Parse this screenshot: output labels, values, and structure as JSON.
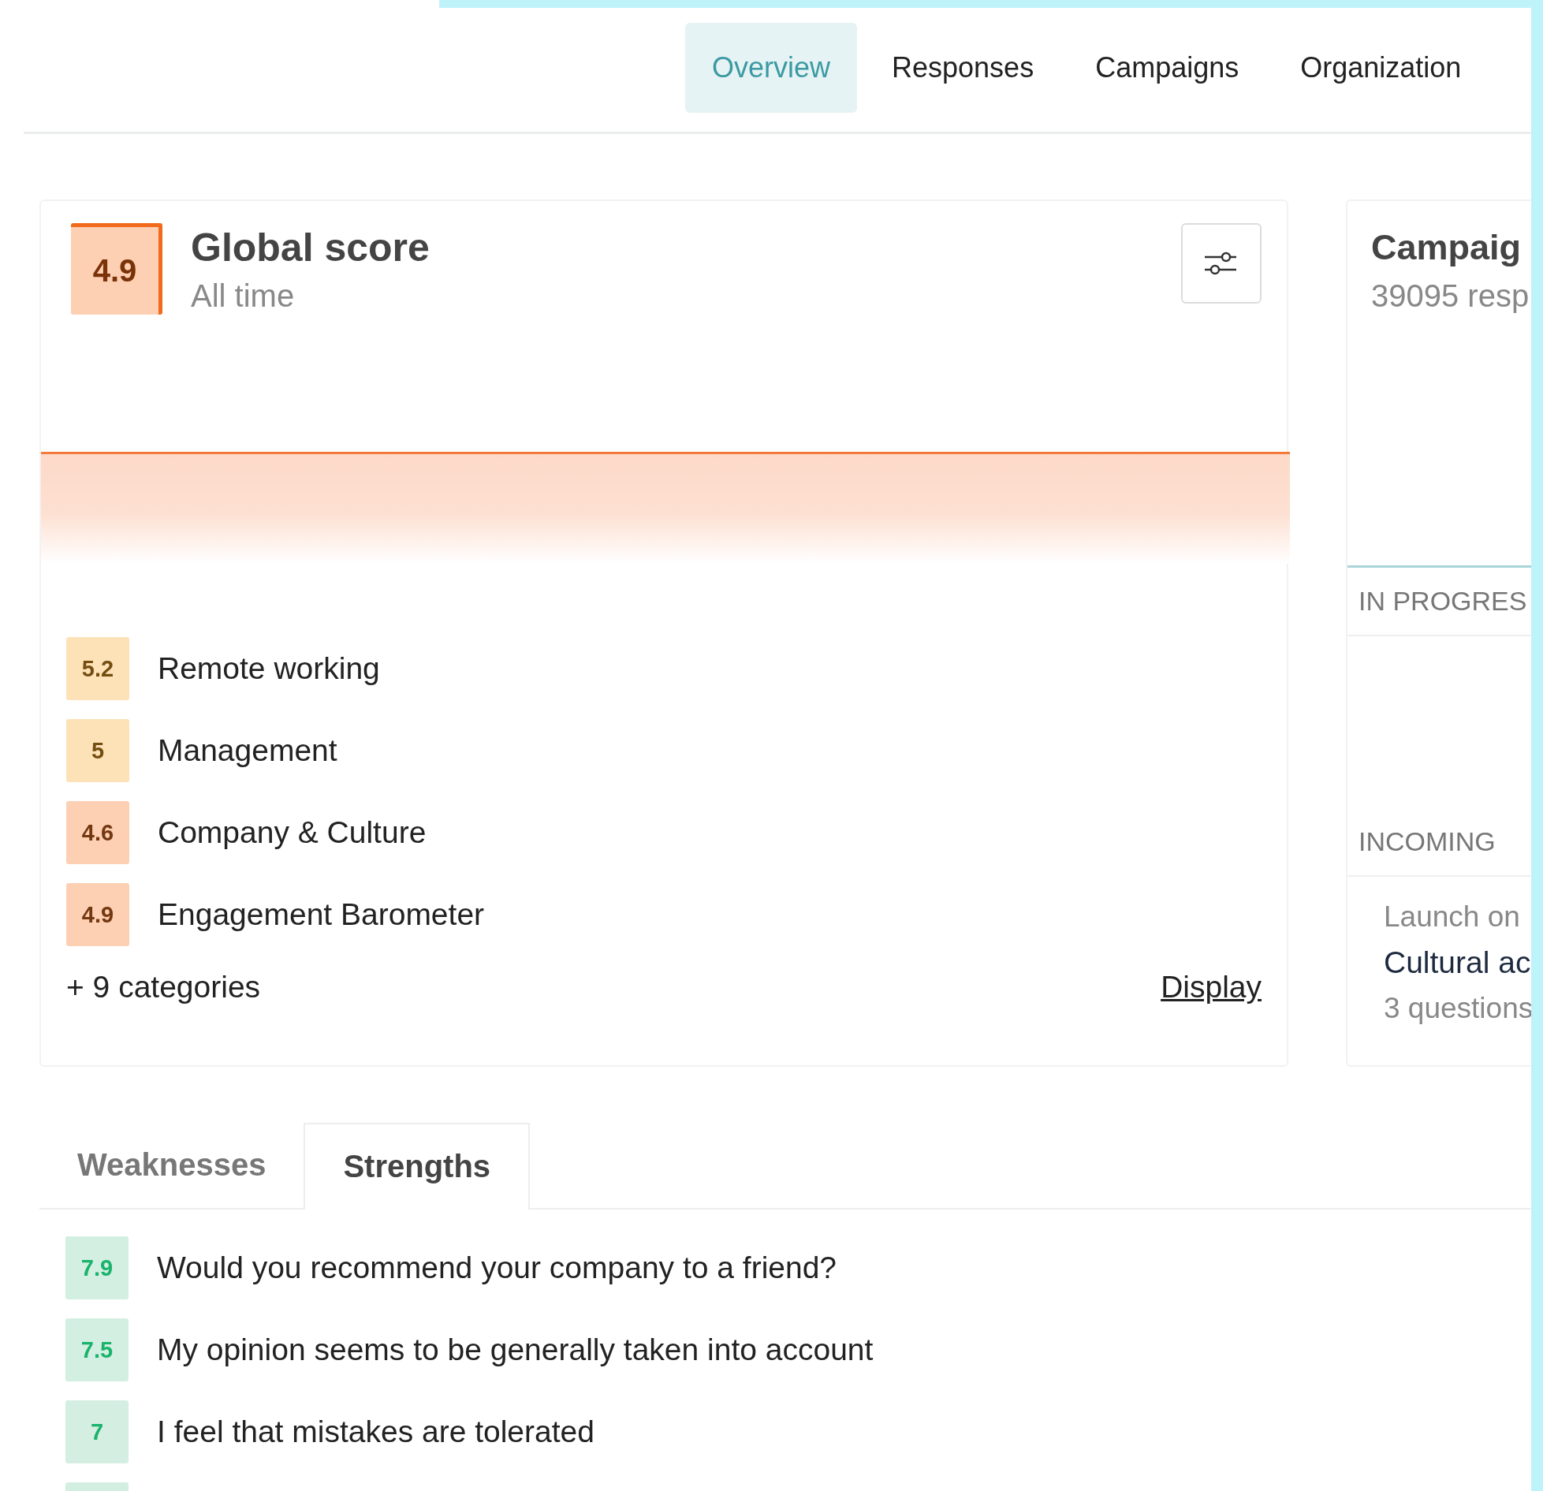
{
  "nav": {
    "tabs": [
      {
        "label": "Overview",
        "selected": true
      },
      {
        "label": "Responses",
        "selected": false
      },
      {
        "label": "Campaigns",
        "selected": false
      },
      {
        "label": "Organization",
        "selected": false
      }
    ]
  },
  "global_score": {
    "score": "4.9",
    "title": "Global score",
    "subtitle": "All time",
    "categories": [
      {
        "score": "5.2",
        "color": "#fde2b8",
        "label": "Remote working"
      },
      {
        "score": "5",
        "color": "#fde2b8",
        "label": "Management"
      },
      {
        "score": "4.6",
        "color": "#fdd0b3",
        "label": "Company & Culture"
      },
      {
        "score": "4.9",
        "color": "#fdd0b3",
        "label": "Engagement Barometer"
      }
    ],
    "more": "+ 9 categories",
    "display_link": "Display"
  },
  "campaigns": {
    "title": "Campaig",
    "subtitle": "39095 resp",
    "sections": [
      {
        "heading": "IN PROGRES"
      },
      {
        "heading": "INCOMING",
        "item": {
          "date": "Launch on",
          "name": "Cultural ac",
          "meta": "3 questions"
        }
      }
    ]
  },
  "result_tabs": [
    {
      "label": "Weaknesses",
      "selected": false
    },
    {
      "label": "Strengths",
      "selected": true
    }
  ],
  "results": [
    {
      "score": "7.9",
      "color": "#d3efe2",
      "label": "Would you recommend your company to a friend?"
    },
    {
      "score": "7.5",
      "color": "#d3efe2",
      "label": "My opinion seems to be generally taken into account"
    },
    {
      "score": "7",
      "color": "#d4eee2",
      "label": "I feel that mistakes are tolerated"
    },
    {
      "color": "#d3efe2"
    }
  ]
}
